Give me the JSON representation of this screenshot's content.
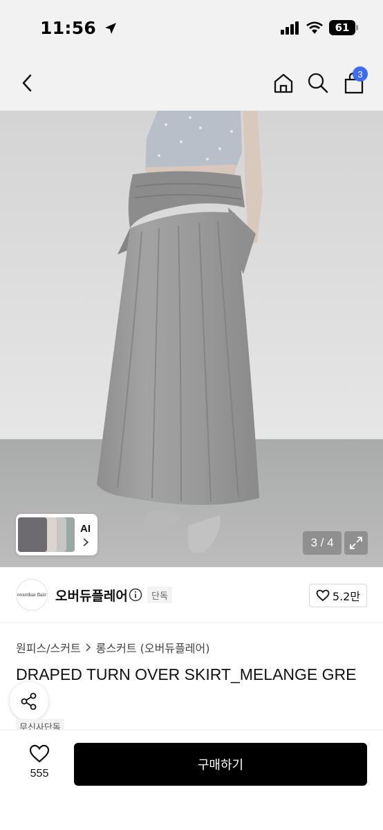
{
  "status_bar": {
    "time": "11:56",
    "battery": "61"
  },
  "nav": {
    "cart_count": "3"
  },
  "image": {
    "page_indicator": "3 / 4",
    "ai_label": "AI"
  },
  "brand": {
    "logo_text": "overdue flair",
    "name": "오버듀플레어",
    "exclusive_tag": "단독",
    "likes": "5.2만"
  },
  "product": {
    "category": "원피스/스커트",
    "subcategory": "롱스커트 (오버듀플레어)",
    "title": "DRAPED TURN OVER SKIRT_MELANGE GRE",
    "store_tag": "무신사단독"
  },
  "bottom": {
    "wish_count": "555",
    "buy_label": "구매하기"
  },
  "colors": {
    "accent": "#3c6cf0",
    "buy_button": "#000000"
  }
}
